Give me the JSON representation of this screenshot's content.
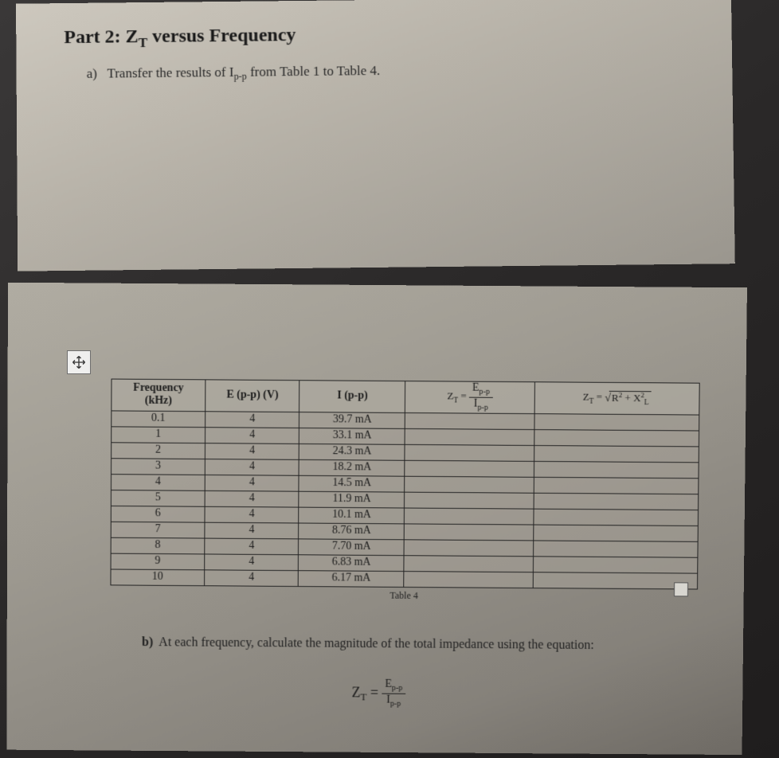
{
  "heading_prefix": "Part 2: Z",
  "heading_sub": "T",
  "heading_suffix": " versus Frequency",
  "item_a_label": "a)",
  "item_a_text": "Transfer the results of I",
  "item_a_sub": "p-p",
  "item_a_text2": " from Table 1 to Table 4.",
  "headers": {
    "freq_line1": "Frequency",
    "freq_line2": "(kHz)",
    "epp": "E (p-p) (V)",
    "ipp": "I (p-p)"
  },
  "formula1_lhs": "Z",
  "formula1_sub": "T",
  "formula1_num": "E",
  "formula1_num_sub": "p-p",
  "formula1_den": "I",
  "formula1_den_sub": "p-p",
  "formula2_lhs": "Z",
  "formula2_sub": "T",
  "formula2_r": "R",
  "formula2_x": "X",
  "formula2_xl": "L",
  "rows": [
    {
      "freq": "0.1",
      "e": "4",
      "i": "39.7 mA"
    },
    {
      "freq": "1",
      "e": "4",
      "i": "33.1 mA"
    },
    {
      "freq": "2",
      "e": "4",
      "i": "24.3 mA"
    },
    {
      "freq": "3",
      "e": "4",
      "i": "18.2 mA"
    },
    {
      "freq": "4",
      "e": "4",
      "i": "14.5 mA"
    },
    {
      "freq": "5",
      "e": "4",
      "i": "11.9 mA"
    },
    {
      "freq": "6",
      "e": "4",
      "i": "10.1 mA"
    },
    {
      "freq": "7",
      "e": "4",
      "i": "8.76 mA"
    },
    {
      "freq": "8",
      "e": "4",
      "i": "7.70 mA"
    },
    {
      "freq": "9",
      "e": "4",
      "i": "6.83 mA"
    },
    {
      "freq": "10",
      "e": "4",
      "i": "6.17 mA"
    }
  ],
  "caption": "Table 4",
  "item_b_label": "b)",
  "item_b_text": "At each frequency, calculate the magnitude of the total impedance using the equation:",
  "eqn_lhs": "Z",
  "eqn_sub": "T",
  "eqn_num": "E",
  "eqn_num_sub": "p-p",
  "eqn_den": "I",
  "eqn_den_sub": "p-p"
}
